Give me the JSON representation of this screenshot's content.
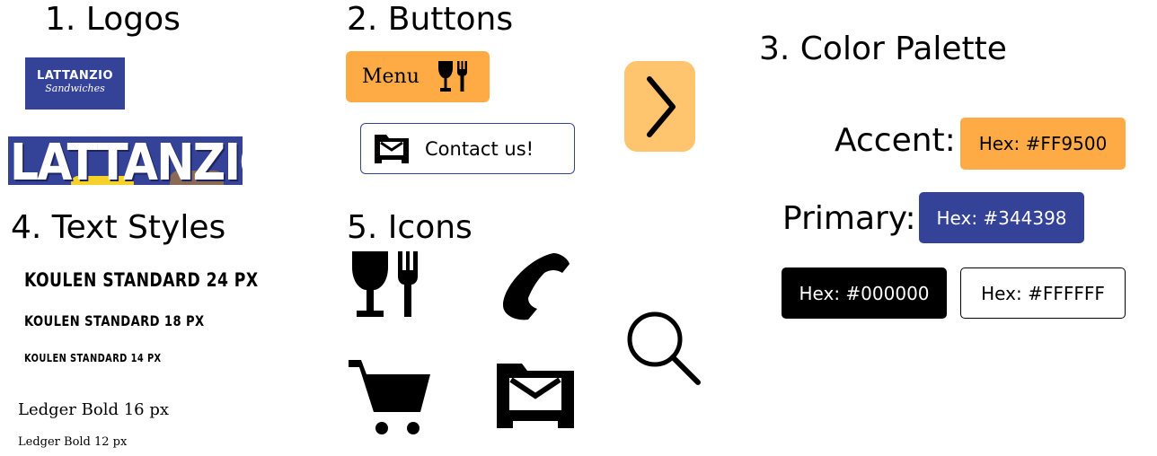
{
  "sections": {
    "logos": "1. Logos",
    "buttons": "2. Buttons",
    "palette": "3. Color Palette",
    "text_styles": "4. Text Styles",
    "icons": "5. Icons"
  },
  "logos": {
    "small": {
      "name": "LATTANZIO",
      "sub": "Sandwiches"
    },
    "large": {
      "name": "LATTANZIO'S"
    }
  },
  "buttons": {
    "menu_label": "Menu",
    "menu_icon": "dining-icon",
    "contact_label": "Contact us!",
    "contact_icon": "mailbox-icon",
    "next_icon": "chevron-right-icon"
  },
  "palette": {
    "accent_label": "Accent:",
    "accent_hex": "Hex: #FF9500",
    "accent_color": "#FFAB45",
    "primary_label": "Primary:",
    "primary_hex": "Hex: #344398",
    "primary_color": "#344398",
    "black_hex": "Hex: #000000",
    "white_hex": "Hex: #FFFFFF"
  },
  "text_styles": [
    "KOULEN STANDARD 24 PX",
    "KOULEN STANDARD 18 PX",
    "KOULEN STANDARD 14 PX",
    "Ledger Bold 16 px",
    "Ledger Bold 12 px"
  ],
  "icons": [
    "dining-icon",
    "phone-icon",
    "search-icon",
    "cart-icon",
    "mailbox-icon"
  ]
}
